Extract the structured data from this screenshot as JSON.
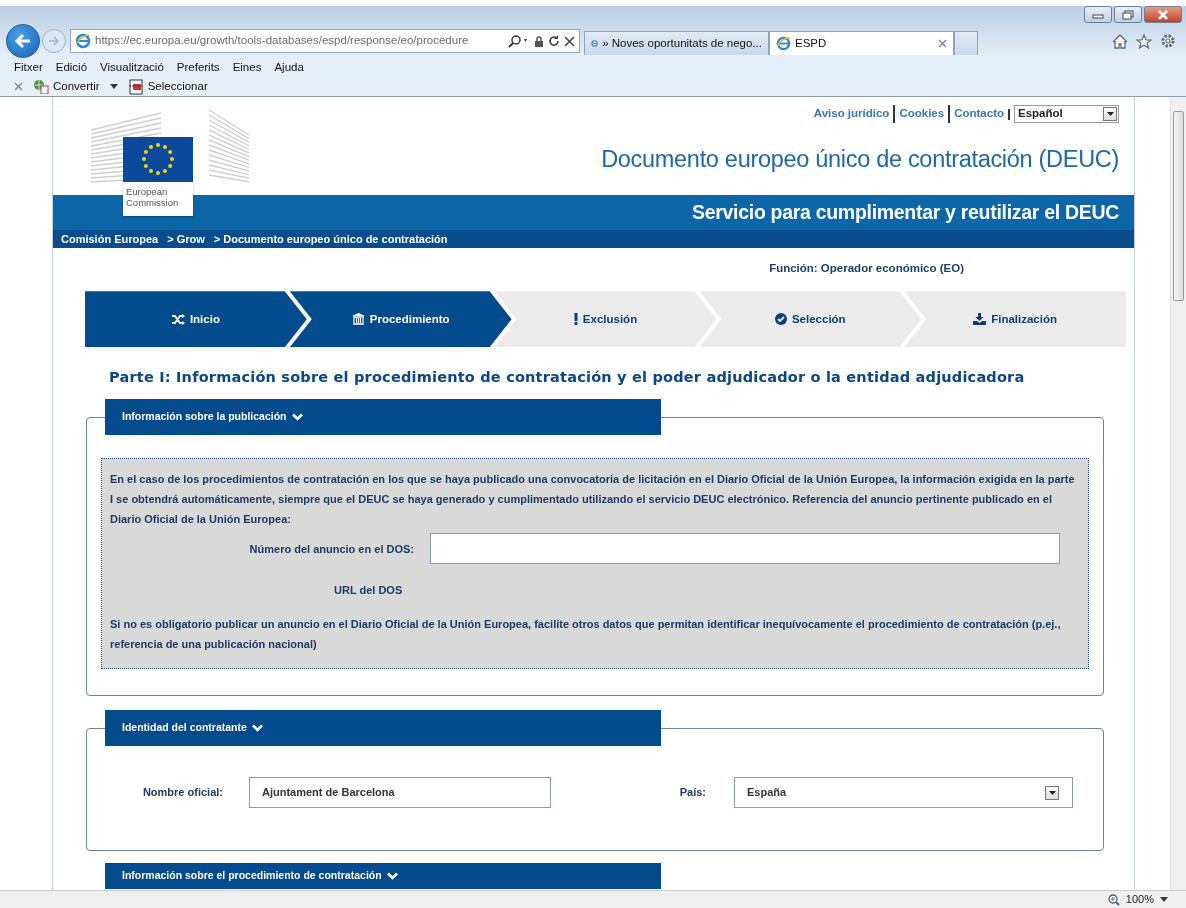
{
  "browser": {
    "address": "https://ec.europa.eu/growth/tools-databases/espd/response/eo/procedure",
    "tabs": [
      {
        "title": "» Noves oportunitats de nego...",
        "selected": false
      },
      {
        "title": "ESPD",
        "selected": true
      }
    ],
    "menu": [
      "Fitxer",
      "Edició",
      "Visualització",
      "Preferits",
      "Eines",
      "Ajuda"
    ],
    "toolbar": [
      {
        "label": "Convertir",
        "kind": "convert"
      },
      {
        "label": "Seleccionar",
        "kind": "select"
      }
    ],
    "status_bar": {
      "zoom": "100%"
    }
  },
  "page": {
    "top_links": [
      "Aviso jurídico",
      "Cookies",
      "Contacto"
    ],
    "language": "Español",
    "logo_text": "European Commission",
    "title": "Documento europeo único de contratación (DEUC)",
    "subtitle": "Servicio para cumplimentar y reutilizar el DEUC",
    "breadcrumb": [
      "Comisión Europea",
      "> Grow",
      "> Documento europeo único de contratación"
    ],
    "role": "Función: Operador económico (EO)",
    "steps": [
      {
        "label": "Inicio",
        "reached": true
      },
      {
        "label": "Procedimiento",
        "reached": true
      },
      {
        "label": "Exclusión",
        "reached": false
      },
      {
        "label": "Selección",
        "reached": false
      },
      {
        "label": "Finalización",
        "reached": false
      }
    ],
    "heading": "Parte I: Información sobre el procedimiento de contratación y el poder adjudicador o la entidad adjudicadora",
    "sections": [
      {
        "title": "Información sobre la publicación",
        "kind": "publication",
        "intro": "En el caso de los procedimientos de contratación en los que se haya publicado una convocatoria de licitación en el Diario Oficial de la Unión Europea, la información exigida en la parte I se obtendrá automáticamente, siempre que el DEUC se haya generado y cumplimentado utilizando el servicio DEUC electrónico. Referencia del anuncio pertinente publicado en el Diario Oficial de la Unión Europea:",
        "notice_label": "Número del anuncio en el DOS:",
        "url_label": "URL del DOS",
        "note": "Si no es obligatorio publicar un anuncio en el Diario Oficial de la Unión Europea, facilite otros datos que permitan identificar inequívocamente el procedimiento de contratación (p.ej., referencia de una publicación nacional)"
      },
      {
        "title": "Identidad del contratante",
        "kind": "identity",
        "name_label": "Nombre oficial:",
        "name_value": "Ajuntament de Barcelona",
        "country_label": "País:",
        "country_value": "España"
      },
      {
        "title": "Información sobre el procedimiento de contratación",
        "kind": "collapsed"
      }
    ]
  }
}
